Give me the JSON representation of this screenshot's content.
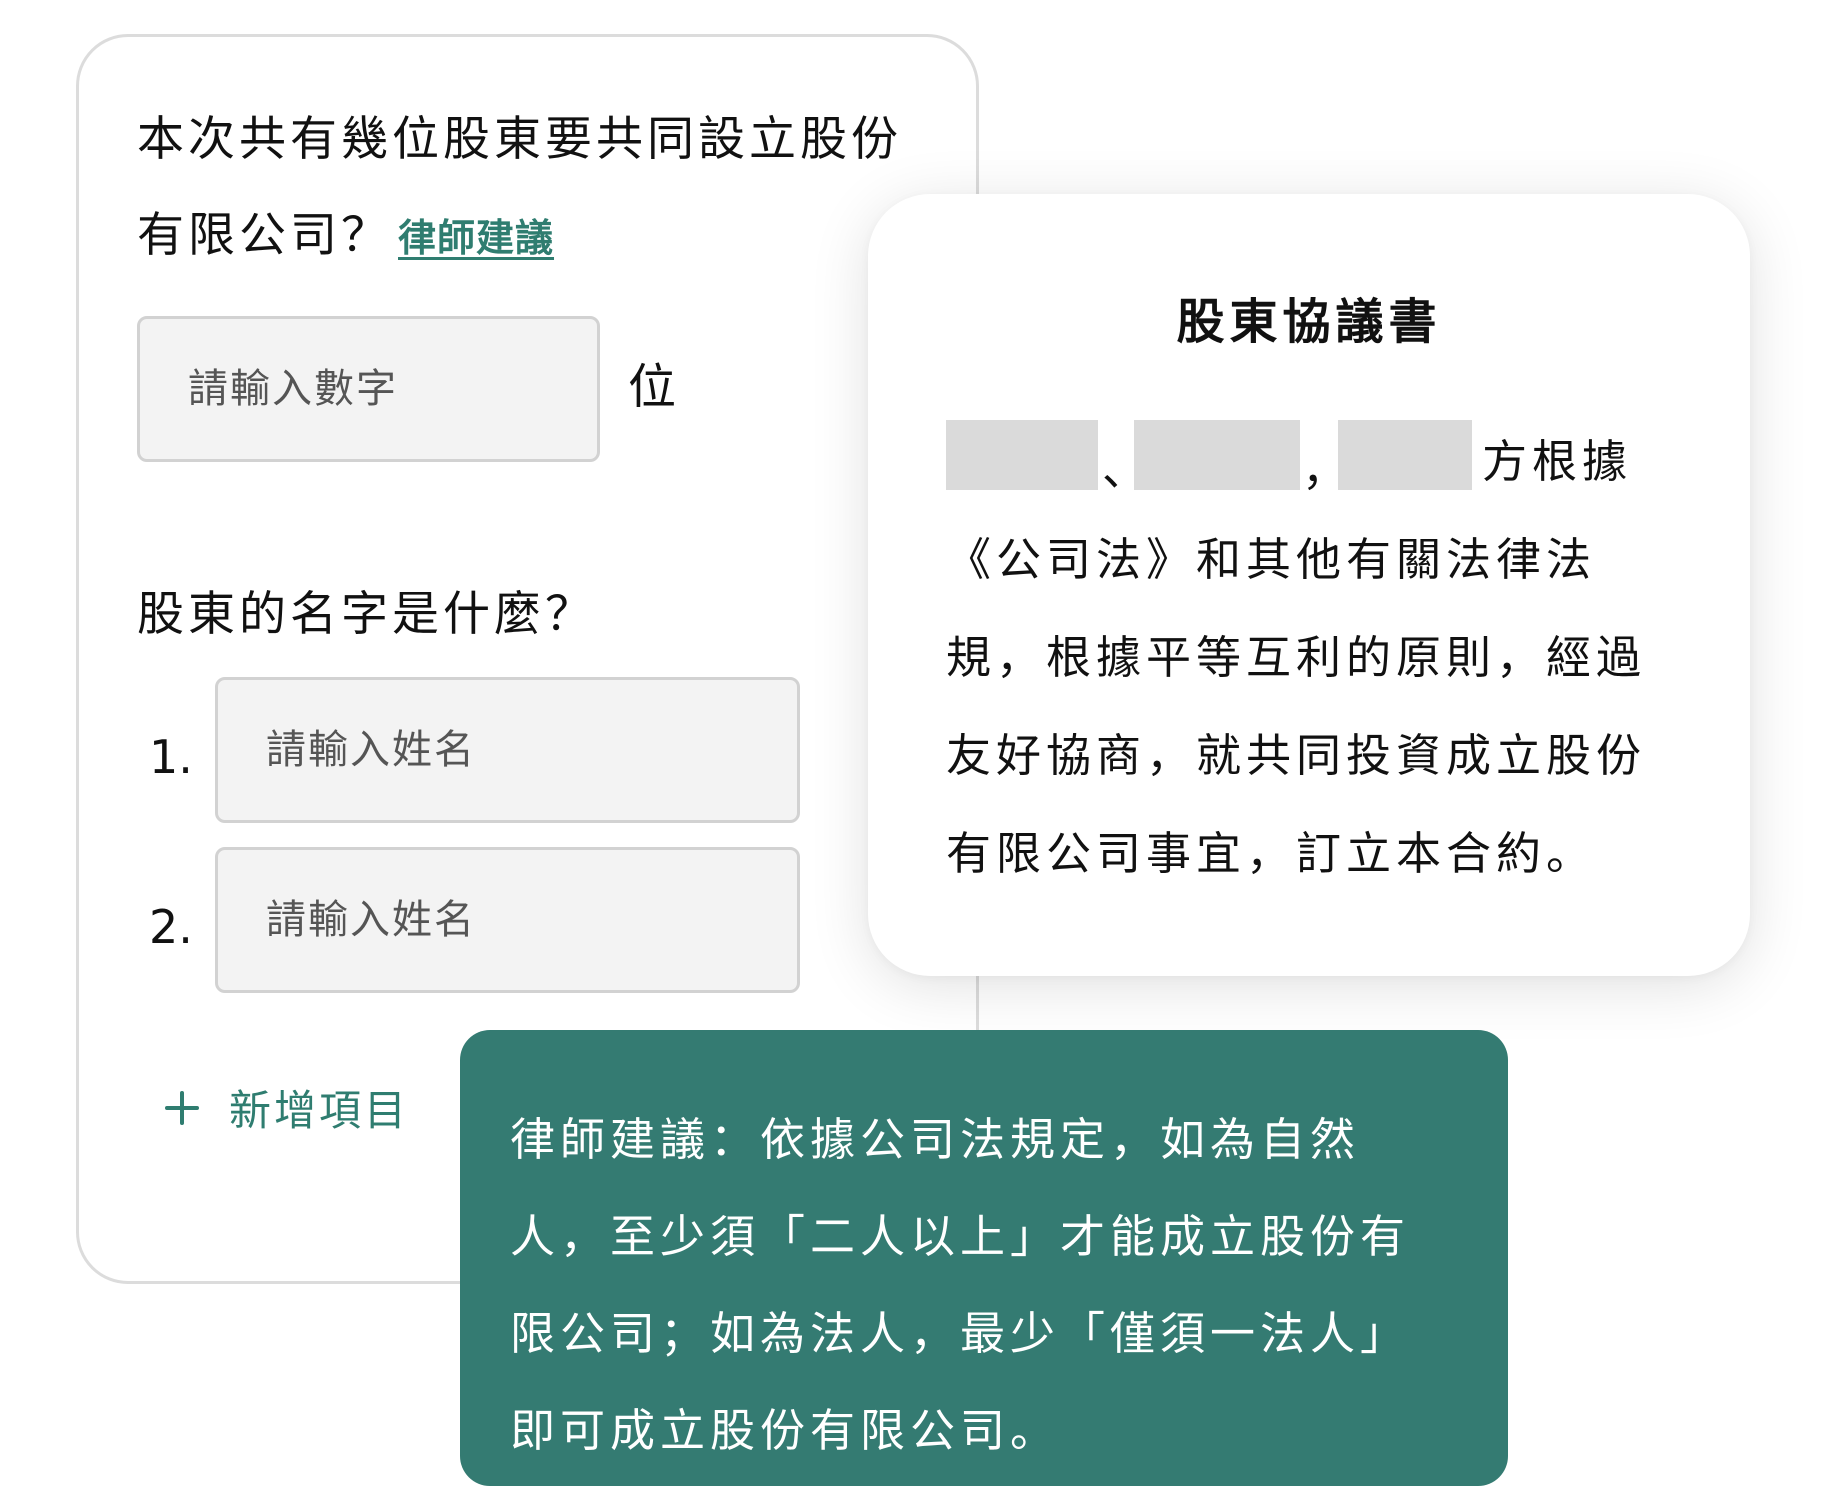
{
  "form": {
    "question_shareholder_count_line1": "本次共有幾位股東要共同設立股份",
    "question_shareholder_count_line2": "有限公司？",
    "lawyer_advice_link": "律師建議",
    "count_input_placeholder": "請輸入數字",
    "count_unit": "位",
    "question_shareholder_names": "股東的名字是什麼？",
    "name_rows": [
      {
        "number": "1.",
        "placeholder": "請輸入姓名"
      },
      {
        "number": "2.",
        "placeholder": "請輸入姓名"
      }
    ],
    "add_item_label": "新增項目"
  },
  "document": {
    "title": "股東協議書",
    "separator_1": "、",
    "separator_2": "，",
    "line1_tail": "方根據",
    "line2": "《公司法》和其他有關法律法",
    "line3": "規，根據平等互利的原則，經過",
    "line4": "友好協商，就共同投資成立股份",
    "line5": "有限公司事宜，訂立本合約。"
  },
  "advice": {
    "line1": "律師建議：依據公司法規定，如為自然",
    "line2": "人，至少須「二人以上」才能成立股份有",
    "line3": "限公司；如為法人，最少「僅須一法人」",
    "line4": "即可成立股份有限公司。"
  },
  "colors": {
    "accent": "#2f7d70",
    "advice_bg": "#347b72",
    "input_bg": "#f3f3f3",
    "blank_fill": "#dadada"
  },
  "icons": {
    "add": "plus-icon"
  }
}
